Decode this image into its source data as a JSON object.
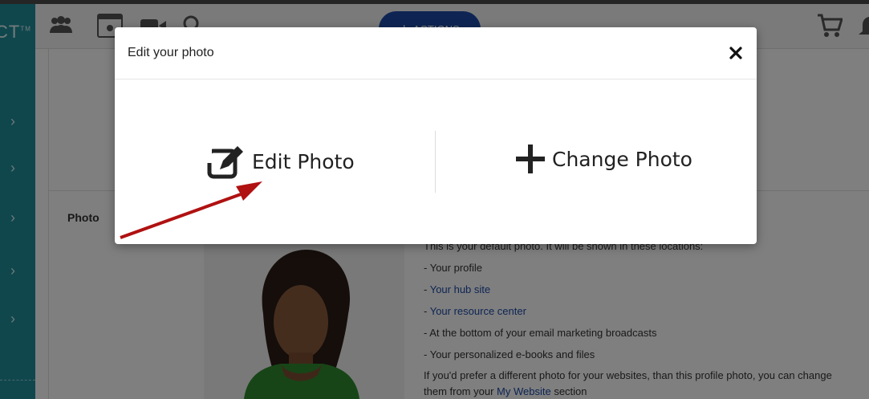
{
  "sidebar": {
    "logo_text": "CT",
    "logo_tm": "TM",
    "chevron": "›"
  },
  "topbar": {
    "actions_label": "ACTIONS",
    "icons": [
      "people-icon",
      "calendar-icon",
      "zoom-icon",
      "search-icon",
      "cart-icon",
      "bell-icon"
    ]
  },
  "profile": {
    "photo_label": "Photo",
    "intro": "This is your default photo. It will be shown in these locations:",
    "items": [
      {
        "prefix": "- ",
        "text": "Your profile",
        "link": false
      },
      {
        "prefix": "- ",
        "text": "Your hub site",
        "link": true
      },
      {
        "prefix": "- ",
        "text": "Your resource center",
        "link": true
      },
      {
        "prefix": "- ",
        "text": "At the bottom of your email marketing broadcasts",
        "link": false
      },
      {
        "prefix": "- ",
        "text": "Your personalized e-books and files",
        "link": false
      }
    ],
    "footer_pre": "If you'd prefer a different photo for your websites, than this profile photo, you can change them from your ",
    "footer_link": "My Website",
    "footer_post": " section"
  },
  "modal": {
    "title": "Edit your photo",
    "edit_label": "Edit Photo",
    "change_label": "Change Photo"
  },
  "colors": {
    "sidebar": "#1f8f9b",
    "accent_blue": "#1d4aa8",
    "arrow_red": "#b01111"
  }
}
